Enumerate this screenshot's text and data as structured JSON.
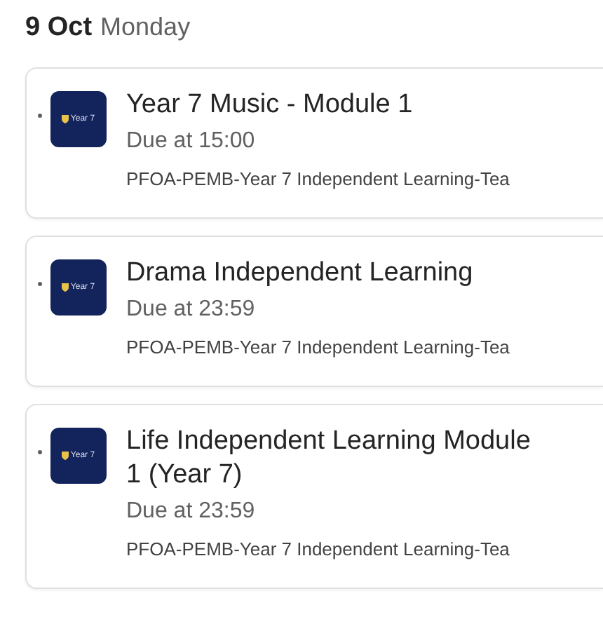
{
  "header": {
    "date": "9 Oct",
    "weekday": "Monday"
  },
  "assignments": [
    {
      "avatar_label": "Year 7",
      "title": "Year 7 Music - Module 1",
      "due": "Due at 15:00",
      "class": "PFOA-PEMB-Year 7 Independent Learning-Tea"
    },
    {
      "avatar_label": "Year 7",
      "title": "Drama Independent Learning",
      "due": "Due at 23:59",
      "class": "PFOA-PEMB-Year 7 Independent Learning-Tea"
    },
    {
      "avatar_label": "Year 7",
      "title": "Life Independent Learning Module 1 (Year 7)",
      "due": "Due at 23:59",
      "class": "PFOA-PEMB-Year 7 Independent Learning-Tea"
    }
  ]
}
